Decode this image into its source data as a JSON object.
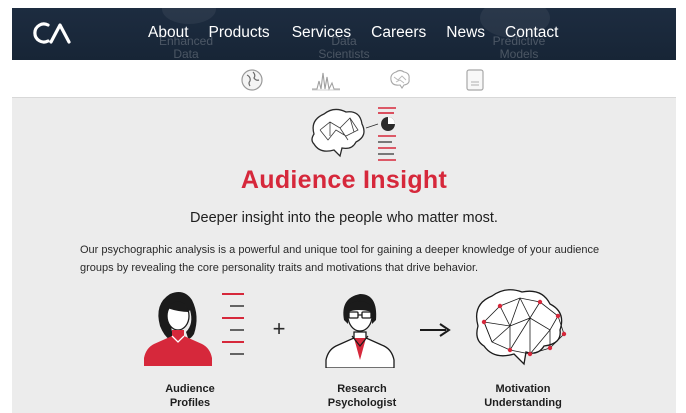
{
  "nav": {
    "logo": "CA",
    "links": [
      "About",
      "Products",
      "Services",
      "Careers",
      "News",
      "Contact"
    ],
    "background_labels": [
      "Enhanced Data",
      "Data Scientists",
      "Predictive Models"
    ]
  },
  "icon_strip": {
    "icons": [
      "globe-icon",
      "waveform-icon",
      "brain-icon",
      "document-icon"
    ]
  },
  "section": {
    "title": "Audience Insight",
    "subtitle": "Deeper insight into the people who matter most.",
    "description": "Our psychographic analysis is a powerful and unique tool for gaining a deeper knowledge of your audience groups by revealing the core personality traits and motivations that drive behavior."
  },
  "diagram": {
    "items": [
      {
        "label_line1": "Audience",
        "label_line2": "Profiles"
      },
      {
        "label_line1": "Research",
        "label_line2": "Psychologist"
      },
      {
        "label_line1": "Motivation",
        "label_line2": "Understanding"
      }
    ],
    "operators": [
      "+",
      "→"
    ]
  },
  "colors": {
    "nav_bg": "#1a283b",
    "accent": "#d6283b",
    "panel_bg": "#ececec",
    "text_dark": "#1e1e1e"
  }
}
